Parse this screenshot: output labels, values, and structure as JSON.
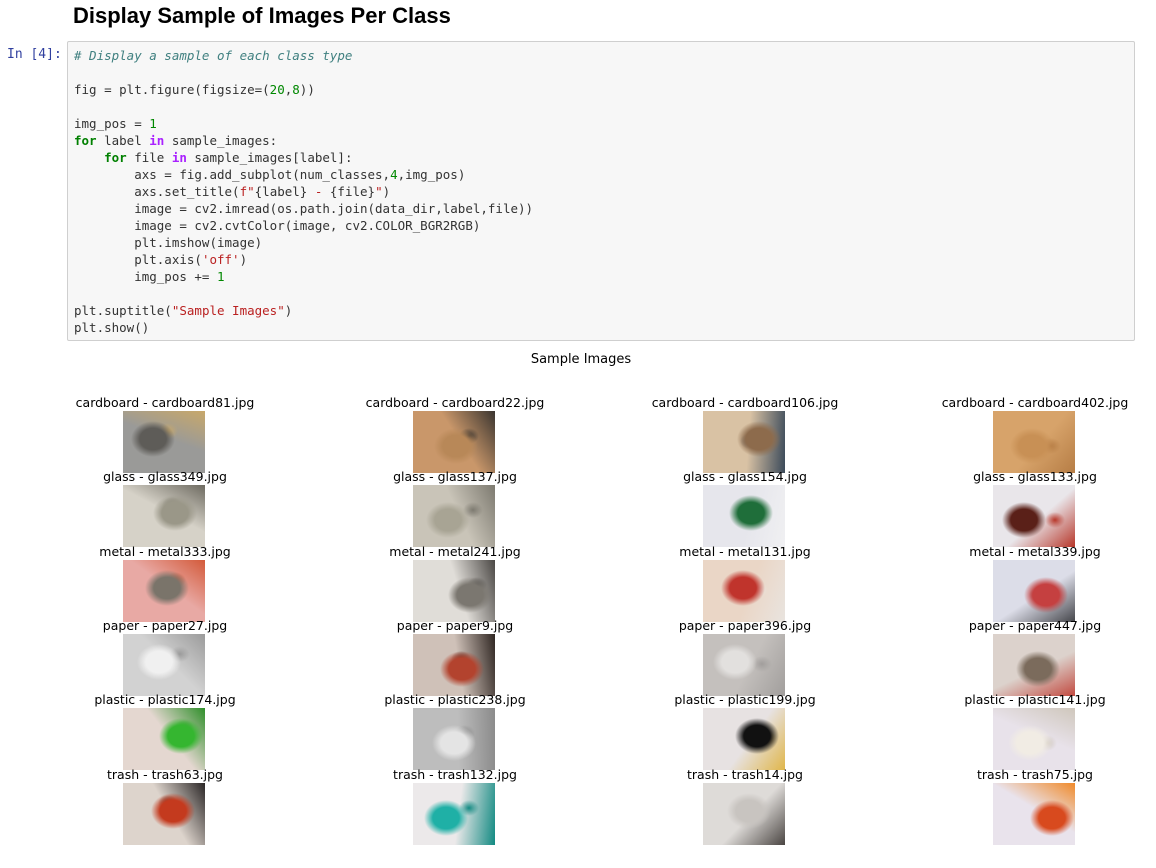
{
  "notebook": {
    "heading": "Display Sample of Images Per Class",
    "prompt": "In [4]:",
    "code_lines": [
      [
        {
          "t": "# Display a sample of each class type",
          "c": "c-comment"
        }
      ],
      [],
      [
        {
          "t": "fig = plt.figure(figsize=(",
          "c": ""
        },
        {
          "t": "20",
          "c": "c-num"
        },
        {
          "t": ",",
          "c": ""
        },
        {
          "t": "8",
          "c": "c-num"
        },
        {
          "t": "))",
          "c": ""
        }
      ],
      [],
      [
        {
          "t": "img_pos = ",
          "c": ""
        },
        {
          "t": "1",
          "c": "c-num"
        }
      ],
      [
        {
          "t": "for",
          "c": "c-kw"
        },
        {
          "t": " label ",
          "c": ""
        },
        {
          "t": "in",
          "c": "c-op"
        },
        {
          "t": " sample_images:",
          "c": ""
        }
      ],
      [
        {
          "t": "    ",
          "c": ""
        },
        {
          "t": "for",
          "c": "c-kw"
        },
        {
          "t": " file ",
          "c": ""
        },
        {
          "t": "in",
          "c": "c-op"
        },
        {
          "t": " sample_images[label]:",
          "c": ""
        }
      ],
      [
        {
          "t": "        axs = fig.add_subplot(num_classes,",
          "c": ""
        },
        {
          "t": "4",
          "c": "c-num"
        },
        {
          "t": ",img_pos)",
          "c": ""
        }
      ],
      [
        {
          "t": "        axs.set_title(",
          "c": ""
        },
        {
          "t": "f\"",
          "c": "c-str"
        },
        {
          "t": "{label}",
          "c": ""
        },
        {
          "t": " - ",
          "c": "c-str"
        },
        {
          "t": "{file}",
          "c": ""
        },
        {
          "t": "\"",
          "c": "c-str"
        },
        {
          "t": ")",
          "c": ""
        }
      ],
      [
        {
          "t": "        image = cv2.imread(os.path.join(data_dir,label,file))",
          "c": ""
        }
      ],
      [
        {
          "t": "        image = cv2.cvtColor(image, cv2.COLOR_BGR2RGB)",
          "c": ""
        }
      ],
      [
        {
          "t": "        plt.imshow(image)",
          "c": ""
        }
      ],
      [
        {
          "t": "        plt.axis(",
          "c": ""
        },
        {
          "t": "'off'",
          "c": "c-str"
        },
        {
          "t": ")",
          "c": ""
        }
      ],
      [
        {
          "t": "        img_pos += ",
          "c": ""
        },
        {
          "t": "1",
          "c": "c-num"
        }
      ],
      [],
      [
        {
          "t": "plt.suptitle(",
          "c": ""
        },
        {
          "t": "\"Sample Images\"",
          "c": "c-str"
        },
        {
          "t": ")",
          "c": ""
        }
      ],
      [
        {
          "t": "plt.show()",
          "c": ""
        }
      ]
    ]
  },
  "output": {
    "suptitle": "Sample Images",
    "rows": [
      [
        "cardboard - cardboard81.jpg",
        "cardboard - cardboard22.jpg",
        "cardboard - cardboard106.jpg",
        "cardboard - cardboard402.jpg"
      ],
      [
        "glass - glass349.jpg",
        "glass - glass137.jpg",
        "glass - glass154.jpg",
        "glass - glass133.jpg"
      ],
      [
        "metal - metal333.jpg",
        "metal - metal241.jpg",
        "metal - metal131.jpg",
        "metal - metal339.jpg"
      ],
      [
        "paper - paper27.jpg",
        "paper - paper9.jpg",
        "paper - paper396.jpg",
        "paper - paper447.jpg"
      ],
      [
        "plastic - plastic174.jpg",
        "plastic - plastic238.jpg",
        "plastic - plastic199.jpg",
        "plastic - plastic141.jpg"
      ],
      [
        "trash - trash63.jpg",
        "trash - trash132.jpg",
        "trash - trash14.jpg",
        "trash - trash75.jpg"
      ]
    ],
    "thumb_colors": [
      [
        [
          "#9a9a98",
          "#5e5c58",
          "#c8a86a"
        ],
        [
          "#c9976a",
          "#b88858",
          "#3a3530"
        ],
        [
          "#d9c2a4",
          "#8d6b4c",
          "#3b4a5a"
        ],
        [
          "#d7a36a",
          "#c89055",
          "#b67d45"
        ]
      ],
      [
        [
          "#d6d2c8",
          "#9a9788",
          "#6d6a60"
        ],
        [
          "#c9c4b8",
          "#a8a494",
          "#7d7a70"
        ],
        [
          "#e6e6ec",
          "#1f6e3a",
          "#f0f0f2"
        ],
        [
          "#e9e6ea",
          "#5a2018",
          "#b7372a"
        ]
      ],
      [
        [
          "#e8a9a4",
          "#7a746a",
          "#d35a3a"
        ],
        [
          "#e0ddd8",
          "#7b7770",
          "#4a4744"
        ],
        [
          "#ead6c6",
          "#c0342c",
          "#e9e4df"
        ],
        [
          "#dcdde8",
          "#c54040",
          "#44454a"
        ]
      ],
      [
        [
          "#d2d2d2",
          "#f0f0f0",
          "#9b9b9b"
        ],
        [
          "#cfc1b8",
          "#b3432e",
          "#2f2622"
        ],
        [
          "#c4c0bd",
          "#e2e0de",
          "#a19e9c"
        ],
        [
          "#dcd2cc",
          "#7b6b5c",
          "#c24a40"
        ]
      ],
      [
        [
          "#e4d7d0",
          "#35b630",
          "#2f8f2a"
        ],
        [
          "#bdbdbd",
          "#e4e4e4",
          "#8b8b8b"
        ],
        [
          "#e7e2e2",
          "#111111",
          "#e0b64a"
        ],
        [
          "#e8e2ea",
          "#f1ece4",
          "#cfc7bc"
        ]
      ],
      [
        [
          "#ddd4cc",
          "#c43a1e",
          "#2a2626"
        ],
        [
          "#ece9ea",
          "#1fb0a6",
          "#128a82"
        ],
        [
          "#dedbd8",
          "#c8c4c0",
          "#4a4542"
        ],
        [
          "#e9e3ec",
          "#d84a1e",
          "#f08a2a"
        ]
      ]
    ]
  }
}
